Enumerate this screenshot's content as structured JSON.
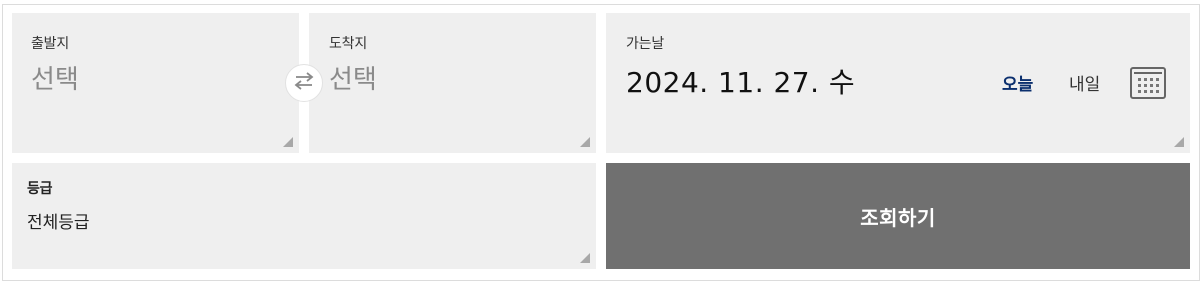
{
  "departure": {
    "label": "출발지",
    "value": "선택"
  },
  "arrival": {
    "label": "도착지",
    "value": "선택"
  },
  "swap": {
    "icon": "swap-arrows-icon"
  },
  "date": {
    "label": "가는날",
    "value": "2024. 11. 27. 수",
    "today_label": "오늘",
    "tomorrow_label": "내일",
    "calendar_icon": "calendar-icon"
  },
  "grade": {
    "label": "등급",
    "value": "전체등급"
  },
  "search": {
    "label": "조회하기"
  },
  "colors": {
    "panel_bg": "#efefef",
    "search_bg": "#707070",
    "today_accent": "#0b2f6e",
    "placeholder": "#8a8a8a"
  }
}
